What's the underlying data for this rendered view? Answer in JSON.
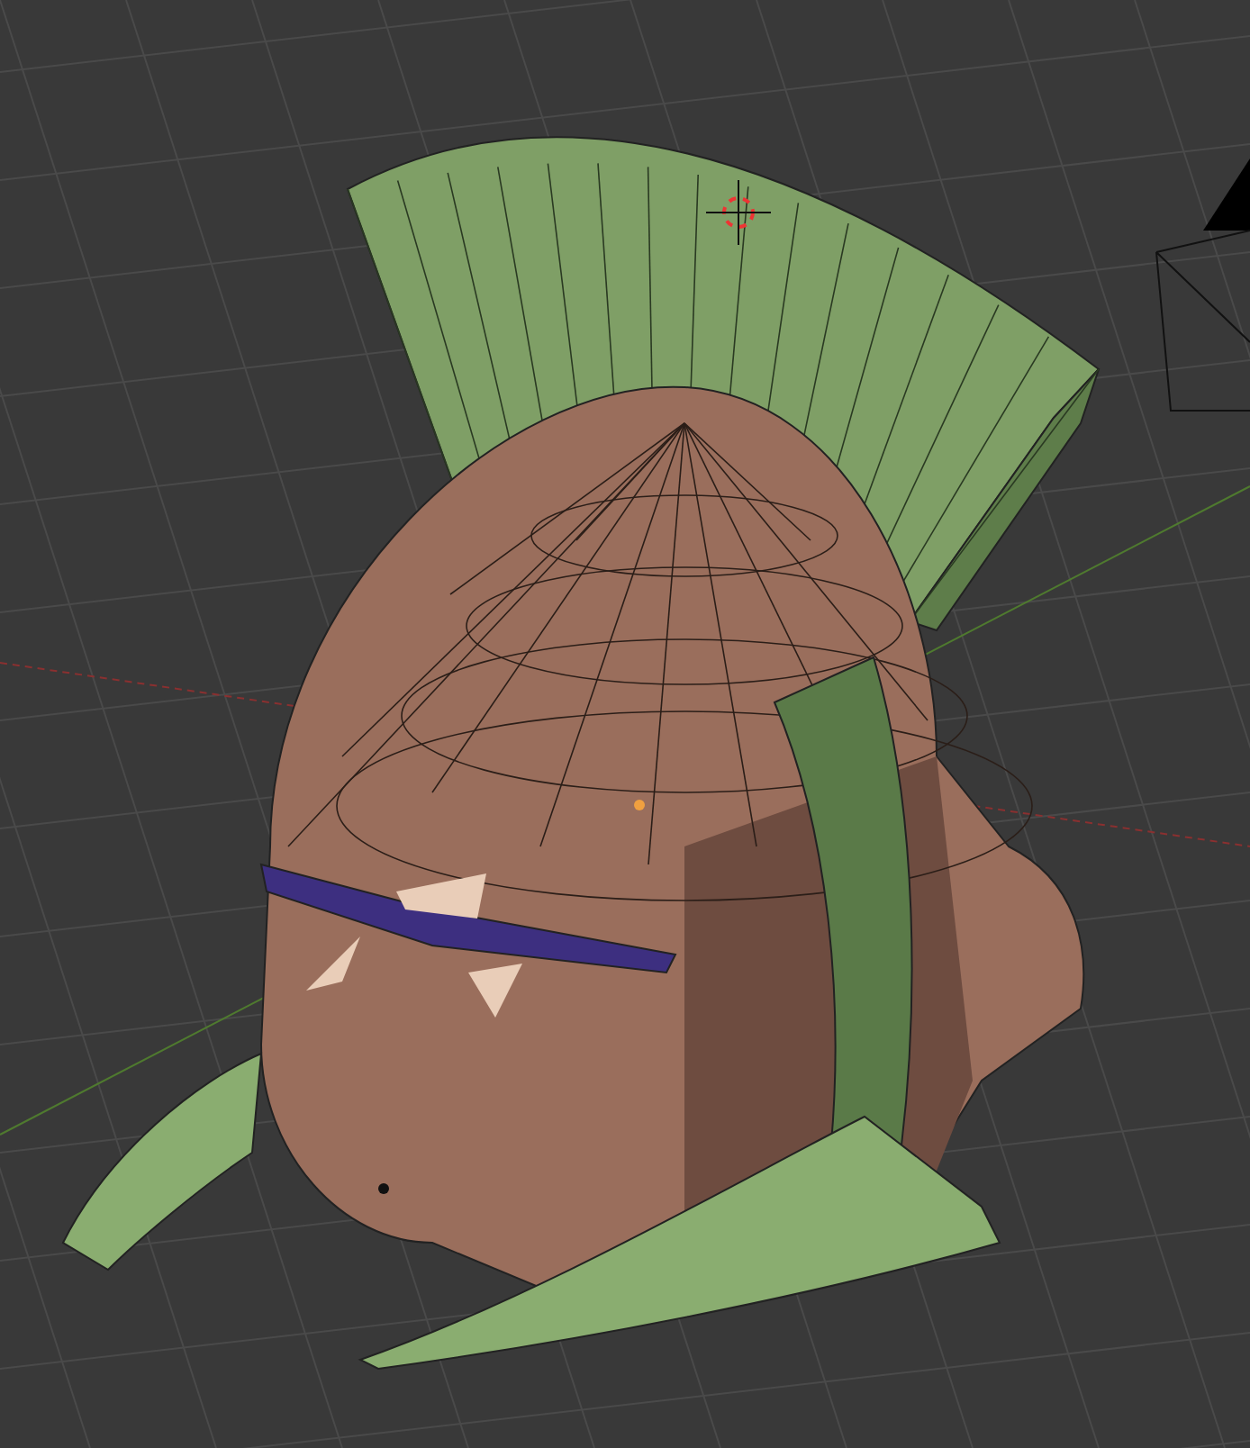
{
  "viewport": {
    "objects": [
      {
        "kind": "mesh"
      },
      {
        "kind": "camera"
      },
      {
        "kind": "cursor"
      }
    ]
  }
}
